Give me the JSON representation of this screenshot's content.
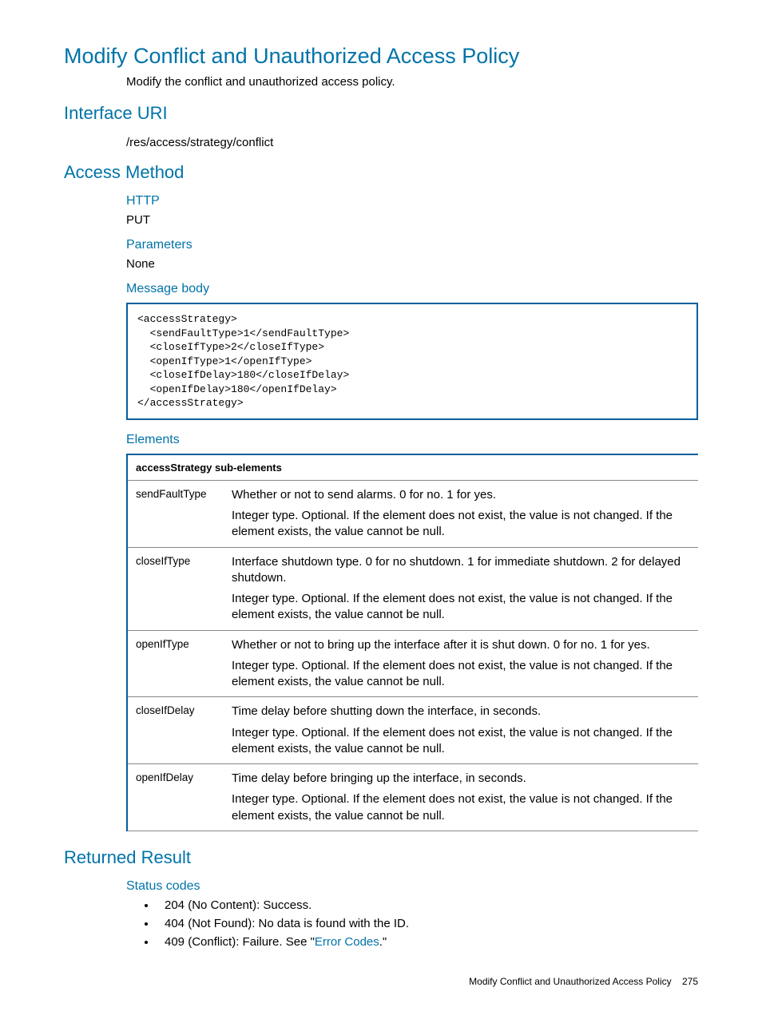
{
  "title": "Modify Conflict and Unauthorized Access Policy",
  "description": "Modify the conflict and unauthorized access policy.",
  "interface_uri": {
    "heading": "Interface URI",
    "value": "/res/access/strategy/conflict"
  },
  "access_method": {
    "heading": "Access Method",
    "http": {
      "heading": "HTTP",
      "value": "PUT"
    },
    "parameters": {
      "heading": "Parameters",
      "value": "None"
    },
    "message_body": {
      "heading": "Message body",
      "code": "<accessStrategy>\n  <sendFaultType>1</sendFaultType>\n  <closeIfType>2</closeIfType>\n  <openIfType>1</openIfType>\n  <closeIfDelay>180</closeIfDelay>\n  <openIfDelay>180</openIfDelay>\n</accessStrategy>"
    },
    "elements": {
      "heading": "Elements",
      "table_header": "accessStrategy sub-elements",
      "rows": [
        {
          "name": "sendFaultType",
          "p1": "Whether or not to send alarms. 0 for no. 1 for yes.",
          "p2": "Integer type. Optional. If the element does not exist, the value is not changed. If the element exists, the value cannot be null."
        },
        {
          "name": "closeIfType",
          "p1": "Interface shutdown type. 0 for no shutdown. 1 for immediate shutdown. 2 for delayed shutdown.",
          "p2": "Integer type. Optional. If the element does not exist, the value is not changed. If the element exists, the value cannot be null."
        },
        {
          "name": "openIfType",
          "p1": "Whether or not to bring up the interface after it is shut down. 0 for no. 1 for yes.",
          "p2": "Integer type. Optional. If the element does not exist, the value is not changed. If the element exists, the value cannot be null."
        },
        {
          "name": "closeIfDelay",
          "p1": "Time delay before shutting down the interface, in seconds.",
          "p2": "Integer type. Optional. If the element does not exist, the value is not changed. If the element exists, the value cannot be null."
        },
        {
          "name": "openIfDelay",
          "p1": "Time delay before bringing up the interface, in seconds.",
          "p2": "Integer type. Optional. If the element does not exist, the value is not changed. If the element exists, the value cannot be null."
        }
      ]
    }
  },
  "returned_result": {
    "heading": "Returned Result",
    "status_codes": {
      "heading": "Status codes",
      "items": [
        {
          "prefix": "204 (No Content): Success."
        },
        {
          "prefix": "404 (Not Found): No data is found with the ID."
        },
        {
          "prefix": "409 (Conflict): Failure. See \"",
          "link": "Error Codes",
          "suffix": ".\""
        }
      ]
    }
  },
  "footer": {
    "title": "Modify Conflict and Unauthorized Access Policy",
    "page": "275"
  }
}
